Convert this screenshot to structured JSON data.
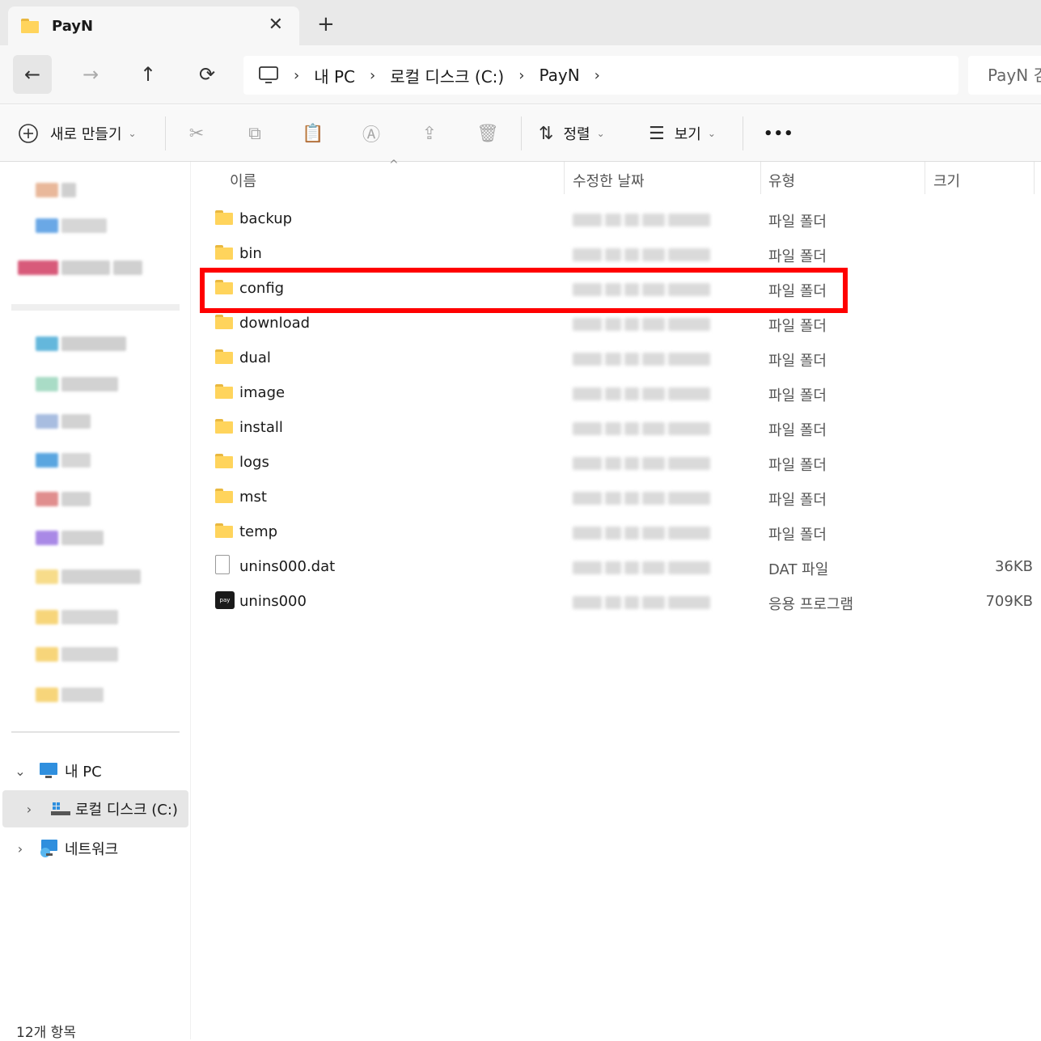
{
  "tab": {
    "title": "PayN",
    "close_label": "✕",
    "new_tab_label": "+"
  },
  "nav": {
    "back": "←",
    "forward": "→",
    "up": "↑",
    "refresh": "⟳"
  },
  "breadcrumb": [
    "내 PC",
    "로컬 디스크 (C:)",
    "PayN"
  ],
  "search": {
    "placeholder": "PayN 검"
  },
  "toolbar": {
    "new_label": "새로 만들기",
    "sort_label": "정렬",
    "view_label": "보기",
    "more_label": "•••"
  },
  "columns": {
    "name": "이름",
    "date": "수정한 날짜",
    "type": "유형",
    "size": "크기"
  },
  "files": [
    {
      "name": "backup",
      "type": "파일 폴더",
      "size": "",
      "icon": "folder"
    },
    {
      "name": "bin",
      "type": "파일 폴더",
      "size": "",
      "icon": "folder"
    },
    {
      "name": "config",
      "type": "파일 폴더",
      "size": "",
      "icon": "folder"
    },
    {
      "name": "download",
      "type": "파일 폴더",
      "size": "",
      "icon": "folder"
    },
    {
      "name": "dual",
      "type": "파일 폴더",
      "size": "",
      "icon": "folder"
    },
    {
      "name": "image",
      "type": "파일 폴더",
      "size": "",
      "icon": "folder"
    },
    {
      "name": "install",
      "type": "파일 폴더",
      "size": "",
      "icon": "folder"
    },
    {
      "name": "logs",
      "type": "파일 폴더",
      "size": "",
      "icon": "folder"
    },
    {
      "name": "mst",
      "type": "파일 폴더",
      "size": "",
      "icon": "folder"
    },
    {
      "name": "temp",
      "type": "파일 폴더",
      "size": "",
      "icon": "folder"
    },
    {
      "name": "unins000.dat",
      "type": "DAT 파일",
      "size": "36KB",
      "icon": "file"
    },
    {
      "name": "unins000",
      "type": "응용 프로그램",
      "size": "709KB",
      "icon": "app"
    }
  ],
  "sidebar": {
    "this_pc": "내 PC",
    "local_disk": "로컬 디스크 (C:)",
    "network": "네트워크"
  },
  "status": {
    "count": "12개 항목"
  },
  "colors": {
    "highlight": "#ff0000",
    "folder": "#ffd45c"
  }
}
